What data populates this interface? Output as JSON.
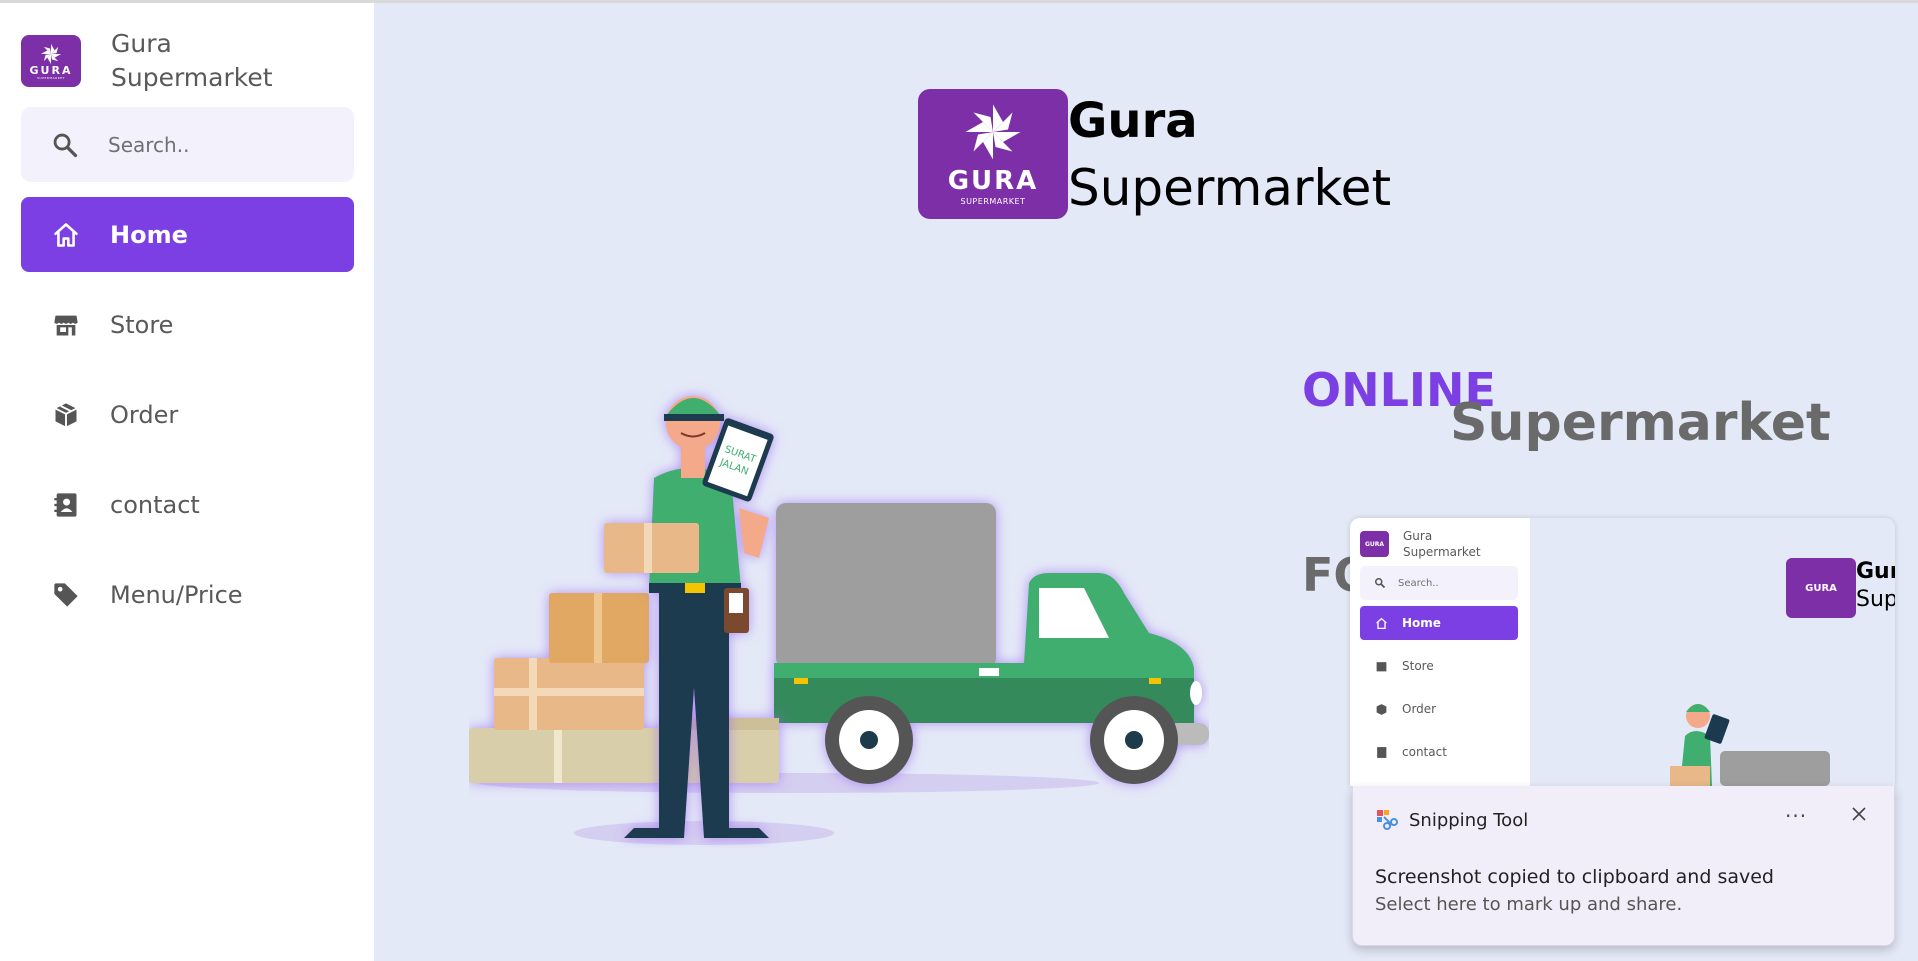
{
  "app": {
    "brand_line1": "Gura",
    "brand_line2": "Supermarket",
    "logo_text": "GURA",
    "logo_sub": "SUPERMARKET"
  },
  "search": {
    "placeholder": "Search.."
  },
  "sidebar": {
    "items": [
      {
        "label": "Home",
        "icon": "home-icon",
        "active": true
      },
      {
        "label": "Store",
        "icon": "store-icon",
        "active": false
      },
      {
        "label": "Order",
        "icon": "box-icon",
        "active": false
      },
      {
        "label": "contact",
        "icon": "contact-book-icon",
        "active": false
      },
      {
        "label": "Menu/Price",
        "icon": "tag-icon",
        "active": false
      }
    ]
  },
  "hero": {
    "title_line1": "Gura",
    "title_line2": "Supermarket",
    "tagline_online": "ONLINE",
    "tagline_super": "Supermarket",
    "tagline_for": "FO",
    "illustration_sign": "SURAT JALAN"
  },
  "preview": {
    "brand_line1": "Gura",
    "brand_line2": "Supermarket",
    "search_placeholder": "Search..",
    "items": [
      "Home",
      "Store",
      "Order",
      "contact"
    ],
    "hero_line1": "Gur",
    "hero_line2": "Sup"
  },
  "toast": {
    "app_name": "Snipping Tool",
    "more": "···",
    "message": "Screenshot copied to clipboard and saved",
    "hint": "Select here to mark up and share."
  },
  "colors": {
    "accent": "#7b3fe4",
    "logo_bg": "#7d2fa8",
    "main_bg": "#e4e9f7",
    "truck_green": "#3fae6e"
  }
}
